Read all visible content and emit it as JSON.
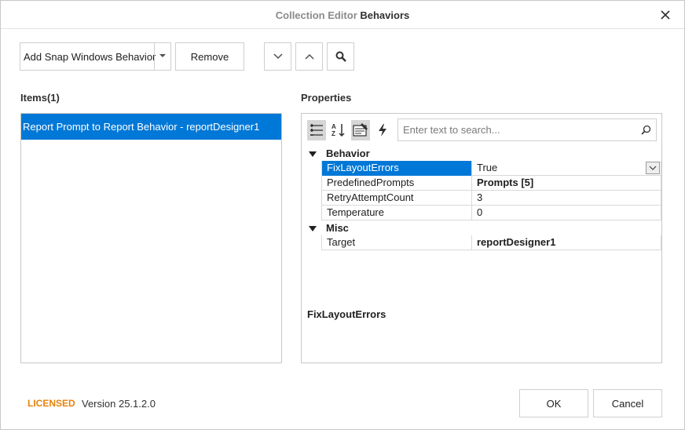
{
  "window": {
    "title_prefix": "Collection Editor",
    "title_main": "Behaviors",
    "close_icon": "close-icon"
  },
  "toolbar": {
    "add_label": "Add Snap Windows Behavior",
    "remove_label": "Remove",
    "move_down_icon": "chevron-down-icon",
    "move_up_icon": "chevron-up-icon",
    "search_icon": "search-icon"
  },
  "items": {
    "label": "Items(1)",
    "list": [
      {
        "text": "Report Prompt to Report Behavior - reportDesigner1",
        "selected": true
      }
    ]
  },
  "properties": {
    "label": "Properties",
    "search_placeholder": "Enter text to search...",
    "toolbar_icons": [
      "categorized-icon",
      "alphabetical-sort-icon",
      "properties-icon",
      "events-icon"
    ],
    "categories": [
      {
        "name": "Behavior",
        "rows": [
          {
            "name": "FixLayoutErrors",
            "value": "True",
            "selected": true,
            "bold": false
          },
          {
            "name": "PredefinedPrompts",
            "value": "Prompts [5]",
            "selected": false,
            "bold": true
          },
          {
            "name": "RetryAttemptCount",
            "value": "3",
            "selected": false,
            "bold": false
          },
          {
            "name": "Temperature",
            "value": "0",
            "selected": false,
            "bold": false
          }
        ]
      },
      {
        "name": "Misc",
        "rows": [
          {
            "name": "Target",
            "value": "reportDesigner1",
            "selected": false,
            "bold": true
          }
        ]
      }
    ],
    "description_title": "FixLayoutErrors"
  },
  "footer": {
    "licensed": "LICENSED",
    "version": "Version 25.1.2.0",
    "ok_label": "OK",
    "cancel_label": "Cancel"
  },
  "colors": {
    "accent": "#0078d7",
    "licensed": "#e8820c"
  }
}
